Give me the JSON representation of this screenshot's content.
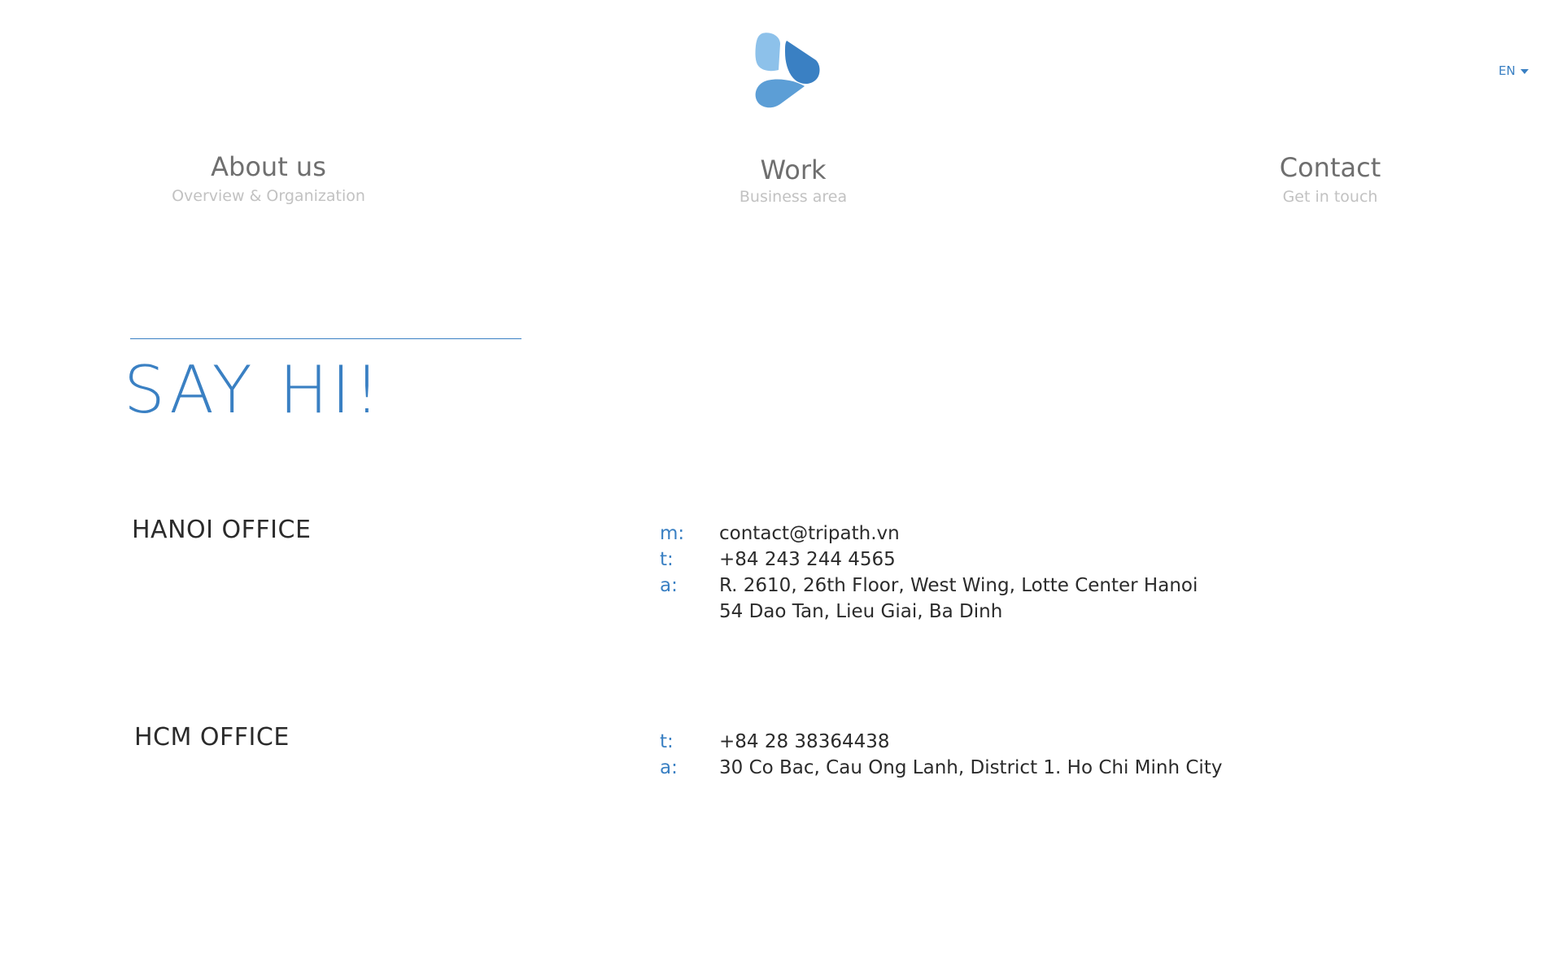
{
  "header": {
    "logo_icon": "droplet-trefoil-logo",
    "colors": {
      "light": "#8dc1ea",
      "mid": "#5c9ed6",
      "dark": "#3a80c3"
    },
    "language": "EN"
  },
  "nav": [
    {
      "title": "About us",
      "subtitle": "Overview & Organization"
    },
    {
      "title": "Work",
      "subtitle": "Business area"
    },
    {
      "title": "Contact",
      "subtitle": "Get in touch"
    }
  ],
  "main": {
    "heading": "SAY HI!",
    "accent_color": "#3a80c3",
    "offices": [
      {
        "name": "HANOI OFFICE",
        "details": [
          {
            "key": "m:",
            "value": "contact@tripath.vn"
          },
          {
            "key": "t:",
            "value": "+84 243 244 4565"
          },
          {
            "key": "a:",
            "value": "R. 2610, 26th Floor, West Wing, Lotte Center Hanoi"
          },
          {
            "key": "",
            "value": "54 Dao Tan, Lieu Giai, Ba Dinh"
          }
        ]
      },
      {
        "name": "HCM OFFICE",
        "details": [
          {
            "key": "t:",
            "value": "+84 28 38364438"
          },
          {
            "key": "a:",
            "value": "30 Co Bac, Cau Ong Lanh, District 1. Ho Chi Minh City"
          }
        ]
      }
    ]
  }
}
